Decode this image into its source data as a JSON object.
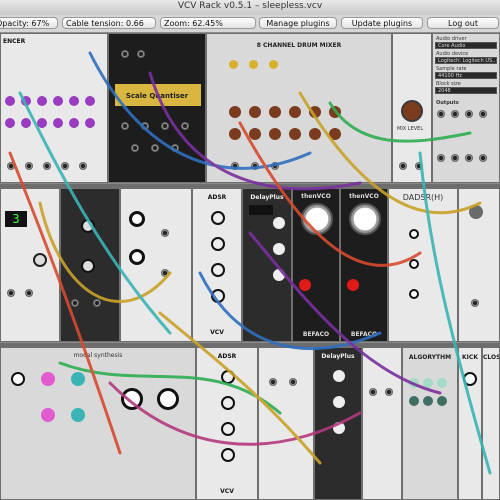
{
  "window": {
    "title": "VCV Rack v0.5.1 – sleepless.vcv"
  },
  "toolbar": {
    "opacity_label": "Opacity: 67%",
    "cable_tension_label": "Cable tension: 0.66",
    "zoom_label": "Zoom: 62.45%",
    "manage_plugins": "Manage plugins",
    "update_plugins": "Update plugins",
    "log_out": "Log out"
  },
  "modules": {
    "sequencer": "ENCER",
    "scale_quantiser": "Scale Quantiser",
    "drum_mixer": "8 CHANNEL DRUM MIXER",
    "mix_level": "MIX LEVEL",
    "outputs": "Outputs",
    "audio": {
      "driver_label": "Audio driver",
      "driver": "Core Audio",
      "device_label": "Audio device",
      "device": "Logitech: Logitech US...",
      "sample_rate_label": "Sample rate",
      "sample_rate": "44100 Hz",
      "block_size_label": "Block size",
      "block_size": "2048"
    },
    "adsr": "ADSR",
    "adsr_bottom": "ADSR",
    "dadsrh": "DADSR(H)",
    "delay_plus": "DelayPlus",
    "delay_plus_bottom": "DelayPlus",
    "then_vco_1": "thenVCO",
    "then_vco_2": "thenVCO",
    "algorithm": "ALGORYTHM",
    "kick": "KICK",
    "close": "CLOSE",
    "vcv_1": "VCV",
    "vcv_2": "VCV",
    "befaco_1": "BEFACO",
    "befaco_2": "BEFACO",
    "digital_display": "3",
    "modal": "modal synthesis"
  },
  "colors": {
    "toolbar_bg": "#d6d6d6",
    "rack_bg": "#3a3a3a",
    "quantiser_gold": "#d9b640",
    "knob_brown": "#7a3b1f",
    "jack_accent_purple": "#8e2fa6",
    "jack_accent_red": "#e01919"
  }
}
